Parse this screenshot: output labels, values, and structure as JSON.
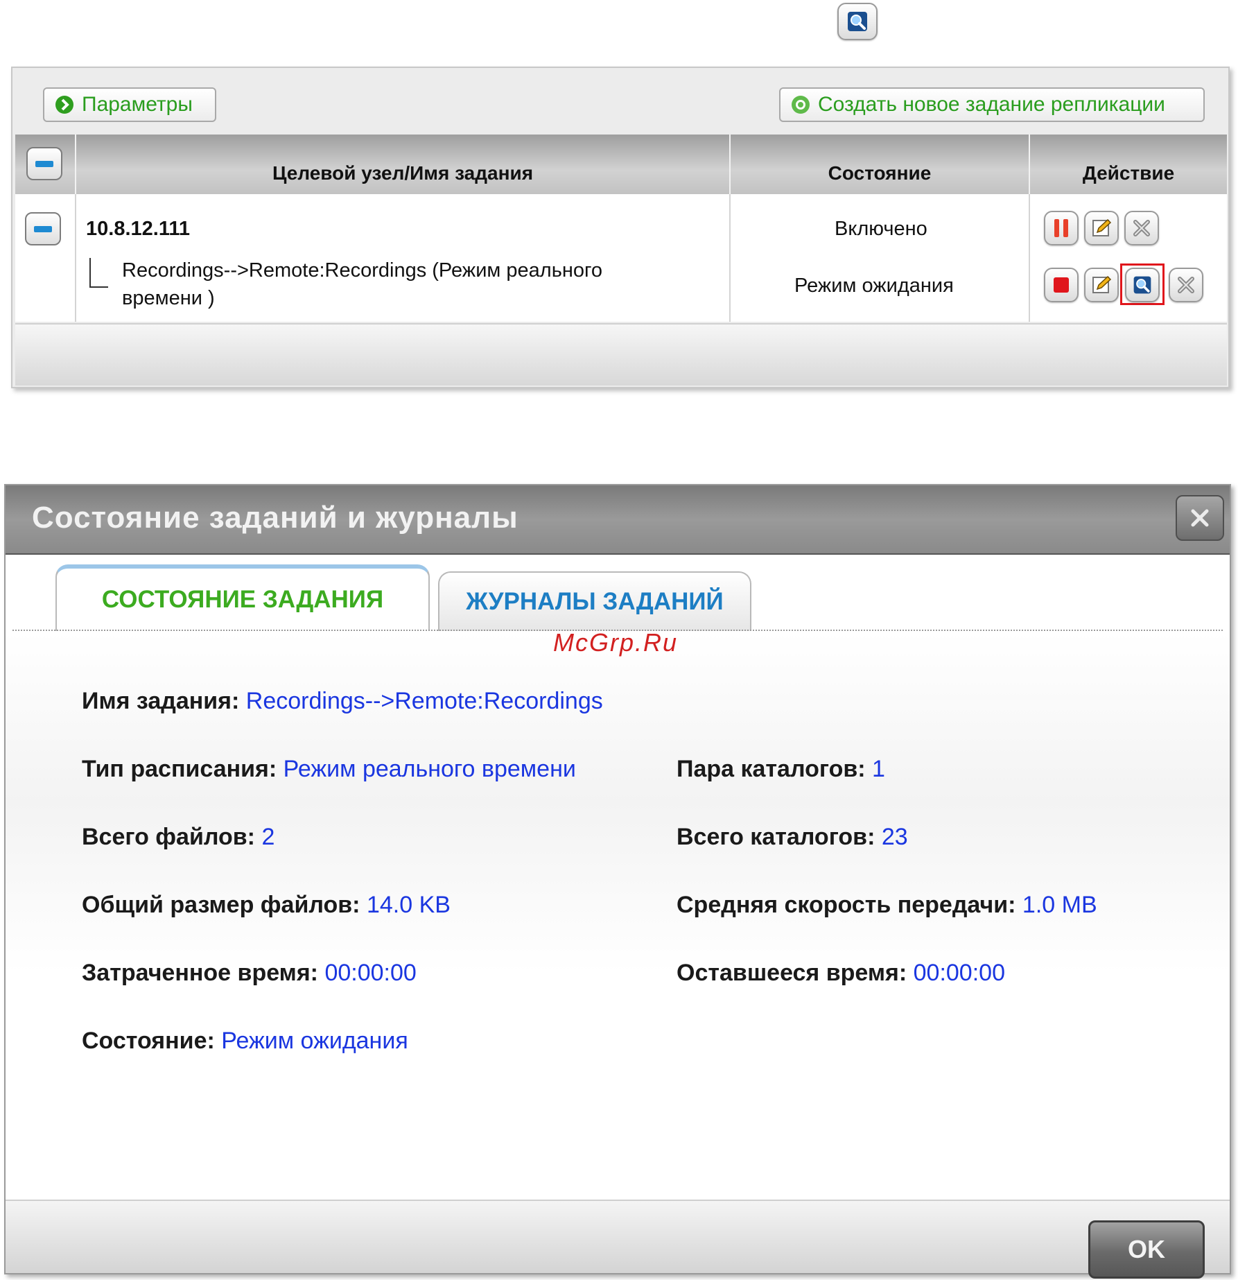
{
  "list_panel": {
    "params_label": "Параметры",
    "create_label": "Создать новое задание репликации",
    "columns": {
      "target": "Целевой узел/Имя задания",
      "state": "Состояние",
      "action": "Действие"
    },
    "host": {
      "name": "10.8.12.111",
      "state": "Включено"
    },
    "job": {
      "name_line1": "Recordings-->Remote:Recordings (Режим реального",
      "name_line2": "времени )",
      "state": "Режим ожидания"
    }
  },
  "dialog": {
    "title": "Состояние заданий и журналы",
    "tabs": {
      "status": "СОСТОЯНИЕ ЗАДАНИЯ",
      "logs": "ЖУРНАЛЫ ЗАДАНИЙ"
    },
    "watermark": "McGrp.Ru",
    "fields": {
      "job_name": {
        "label": "Имя задания:",
        "value": "Recordings-->Remote:Recordings"
      },
      "schedule_type": {
        "label": "Тип расписания:",
        "value": "Режим реального времени"
      },
      "folder_pairs": {
        "label": "Пара каталогов:",
        "value": "1"
      },
      "total_files": {
        "label": "Всего файлов:",
        "value": "2"
      },
      "total_folders": {
        "label": "Всего каталогов:",
        "value": "23"
      },
      "total_size": {
        "label": "Общий размер файлов:",
        "value": "14.0 KB"
      },
      "avg_speed": {
        "label": "Средняя скорость передачи:",
        "value": "1.0 MB"
      },
      "elapsed": {
        "label": "Затраченное время:",
        "value": "00:00:00"
      },
      "remaining": {
        "label": "Оставшееся время:",
        "value": "00:00:00"
      },
      "status": {
        "label": "Состояние:",
        "value": "Режим ожидания"
      }
    },
    "ok_label": "OK"
  },
  "colors": {
    "accent_green": "#3cab20",
    "link_blue": "#1a36e0",
    "tab_blue": "#1d7ec4",
    "highlight_red": "#e0161c"
  }
}
